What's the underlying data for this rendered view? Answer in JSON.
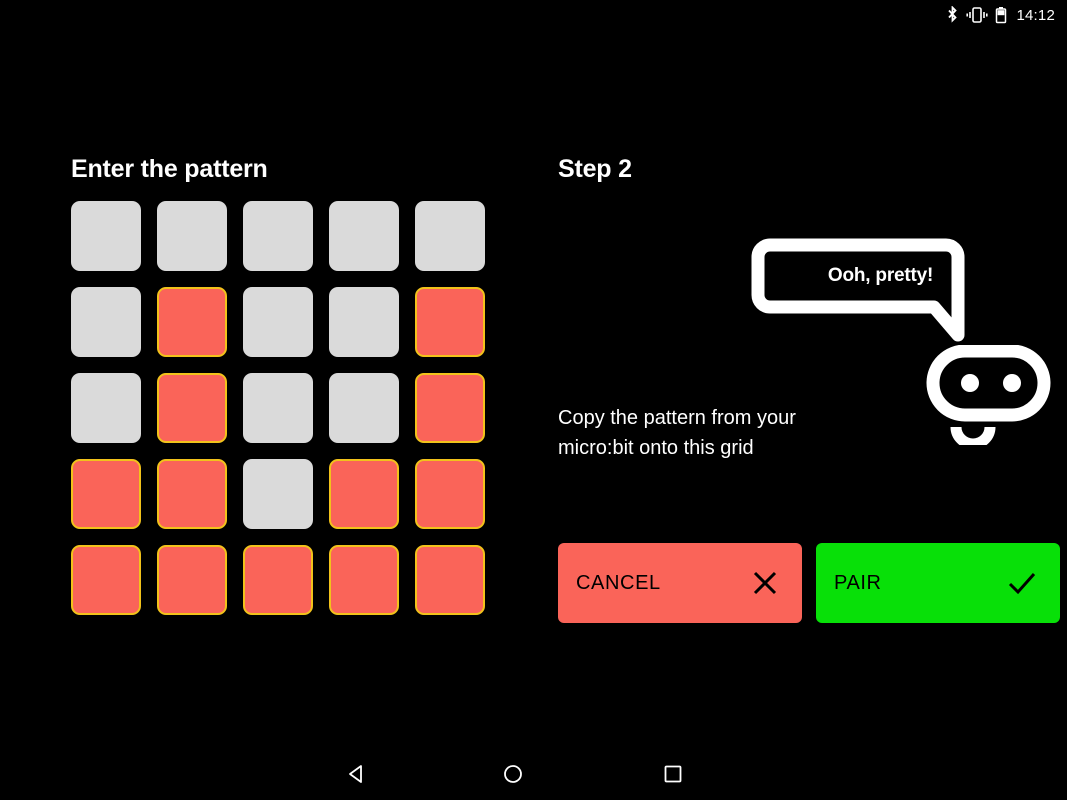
{
  "status_bar": {
    "bluetooth_icon": "bluetooth-icon",
    "vibrate_icon": "vibrate-icon",
    "battery_icon": "battery-icon",
    "clock": "14:12"
  },
  "left_panel": {
    "title": "Enter the pattern",
    "grid": {
      "rows": 5,
      "cols": 5,
      "on_color": "#fa6459",
      "off_color": "#dadada",
      "on_border_color": "#f2c21b",
      "cells": [
        [
          0,
          0,
          0,
          0,
          0
        ],
        [
          0,
          1,
          0,
          0,
          1
        ],
        [
          0,
          1,
          0,
          0,
          1
        ],
        [
          1,
          1,
          0,
          1,
          1
        ],
        [
          1,
          1,
          1,
          1,
          1
        ]
      ]
    }
  },
  "right_panel": {
    "step_title": "Step 2",
    "speech_bubble": "Ooh, pretty!",
    "robot_icon": "robot-face-icon",
    "instruction": "Copy the pattern from your micro:bit onto this grid",
    "buttons": {
      "cancel": {
        "label": "CANCEL",
        "icon": "close-x-icon",
        "color": "#fa6459"
      },
      "pair": {
        "label": "PAIR",
        "icon": "check-icon",
        "color": "#08e008"
      }
    }
  },
  "nav_bar": {
    "back_icon": "back-triangle-icon",
    "home_icon": "home-circle-icon",
    "recents_icon": "recents-square-icon"
  }
}
